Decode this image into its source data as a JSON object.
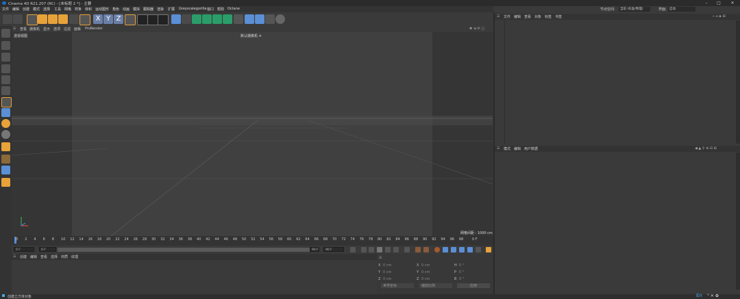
{
  "window": {
    "title": "Cinema 4D R21.207 (RC) - [未标题 2 *] - 主要",
    "min": "–",
    "max": "□",
    "close": "✕"
  },
  "menubar": {
    "items": [
      "文件",
      "编辑",
      "创建",
      "模式",
      "选择",
      "工具",
      "网格",
      "样条",
      "体积",
      "运动图形",
      "角色",
      "动画",
      "模拟",
      "跟踪器",
      "渲染",
      "扩展",
      "Greyscalegorilla",
      "窗口",
      "帮助",
      "Octane"
    ]
  },
  "layout": {
    "label": "节点空间:",
    "value": "当前 (标准/物理)",
    "interface_label": "界面:",
    "interface_value": "启动"
  },
  "viewport": {
    "menu": [
      "查看",
      "摄像机",
      "显示",
      "选项",
      "过滤",
      "面板",
      "ProRender"
    ],
    "view_name": "透视视图",
    "camera": "默认摄像机 ✳︎",
    "grid_spacing": "网格间距 : 1000 cm"
  },
  "timeline": {
    "ticks": [
      "0",
      "2",
      "4",
      "6",
      "8",
      "10",
      "12",
      "14",
      "16",
      "18",
      "20",
      "22",
      "24",
      "26",
      "28",
      "30",
      "32",
      "34",
      "36",
      "38",
      "40",
      "42",
      "44",
      "46",
      "48",
      "50",
      "52",
      "54",
      "56",
      "58",
      "60",
      "62",
      "64",
      "66",
      "68",
      "70",
      "72",
      "74",
      "76",
      "78",
      "80",
      "82",
      "84",
      "86",
      "88",
      "90",
      "92",
      "94",
      "96",
      "98"
    ],
    "end_label": "0 F",
    "start_field": "0 F",
    "current_field": "0 F",
    "end_field": "90 F",
    "end_field2": "90 F"
  },
  "bottom": {
    "tabs": [
      "创建",
      "编辑",
      "查看",
      "选择",
      "材质",
      "纹理"
    ]
  },
  "coordinates": {
    "rows": [
      {
        "a": "X",
        "av": "0 cm",
        "b": "X",
        "bv": "0 cm",
        "c": "H",
        "cv": "0 °"
      },
      {
        "a": "Y",
        "av": "0 cm",
        "b": "Y",
        "bv": "0 cm",
        "c": "P",
        "cv": "0 °"
      },
      {
        "a": "Z",
        "av": "0 cm",
        "b": "Z",
        "bv": "0 cm",
        "c": "B",
        "cv": "0 °"
      }
    ],
    "mode1": "世界坐标",
    "mode2": "缩放比例",
    "apply": "应用"
  },
  "objects_panel": {
    "tabs": [
      "文件",
      "编辑",
      "查看",
      "对象",
      "标签",
      "书签"
    ]
  },
  "attributes_panel": {
    "tabs": [
      "模式",
      "编辑",
      "用户数据"
    ]
  },
  "status": {
    "text": "创建立方体对象",
    "ime": "En"
  },
  "colors": {
    "accent_orange": "#e8a23a",
    "accent_blue": "#2d7fd3",
    "toolbar_active": "#5b8fd6"
  }
}
